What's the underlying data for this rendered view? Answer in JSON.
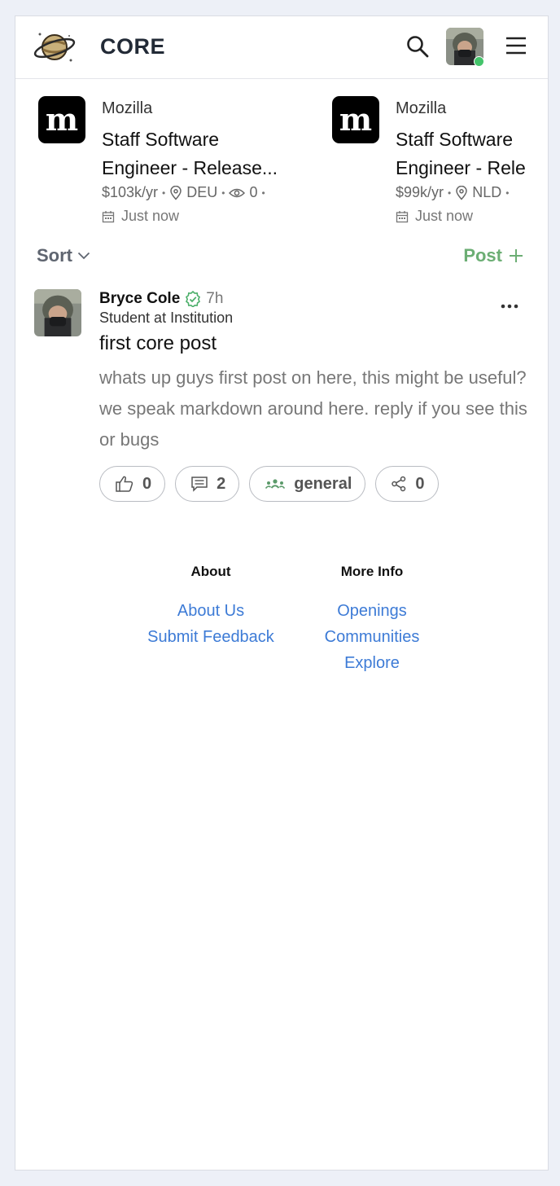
{
  "header": {
    "brand": "CORE",
    "accent": "#222a36"
  },
  "jobs": [
    {
      "company": "Mozilla",
      "logo_letter": "m",
      "title_line1": "Staff Software",
      "title_line2": "Engineer - Release...",
      "salary": "$103k/yr",
      "location": "DEU",
      "views": "0",
      "posted": "Just now"
    },
    {
      "company": "Mozilla",
      "logo_letter": "m",
      "title_line1": "Staff Software",
      "title_line2": "Engineer - Rele",
      "salary": "$99k/yr",
      "location": "NLD",
      "posted": "Just now"
    }
  ],
  "feed_controls": {
    "sort_label": "Sort",
    "post_label": "Post",
    "post_color": "#6cae74"
  },
  "post": {
    "author": "Bryce Cole",
    "time": "7h",
    "headline": "Student at Institution",
    "title": "first core post",
    "body": "whats up guys first post on here, this might be useful? we speak markdown around here. reply if you see this or bugs",
    "likes": "0",
    "comments": "2",
    "community": "general",
    "shares": "0"
  },
  "footer": {
    "about": {
      "heading": "About",
      "links": [
        "About Us",
        "Submit Feedback"
      ]
    },
    "more_info": {
      "heading": "More Info",
      "links": [
        "Openings",
        "Communities",
        "Explore"
      ]
    },
    "link_color": "#3d7bd6"
  }
}
